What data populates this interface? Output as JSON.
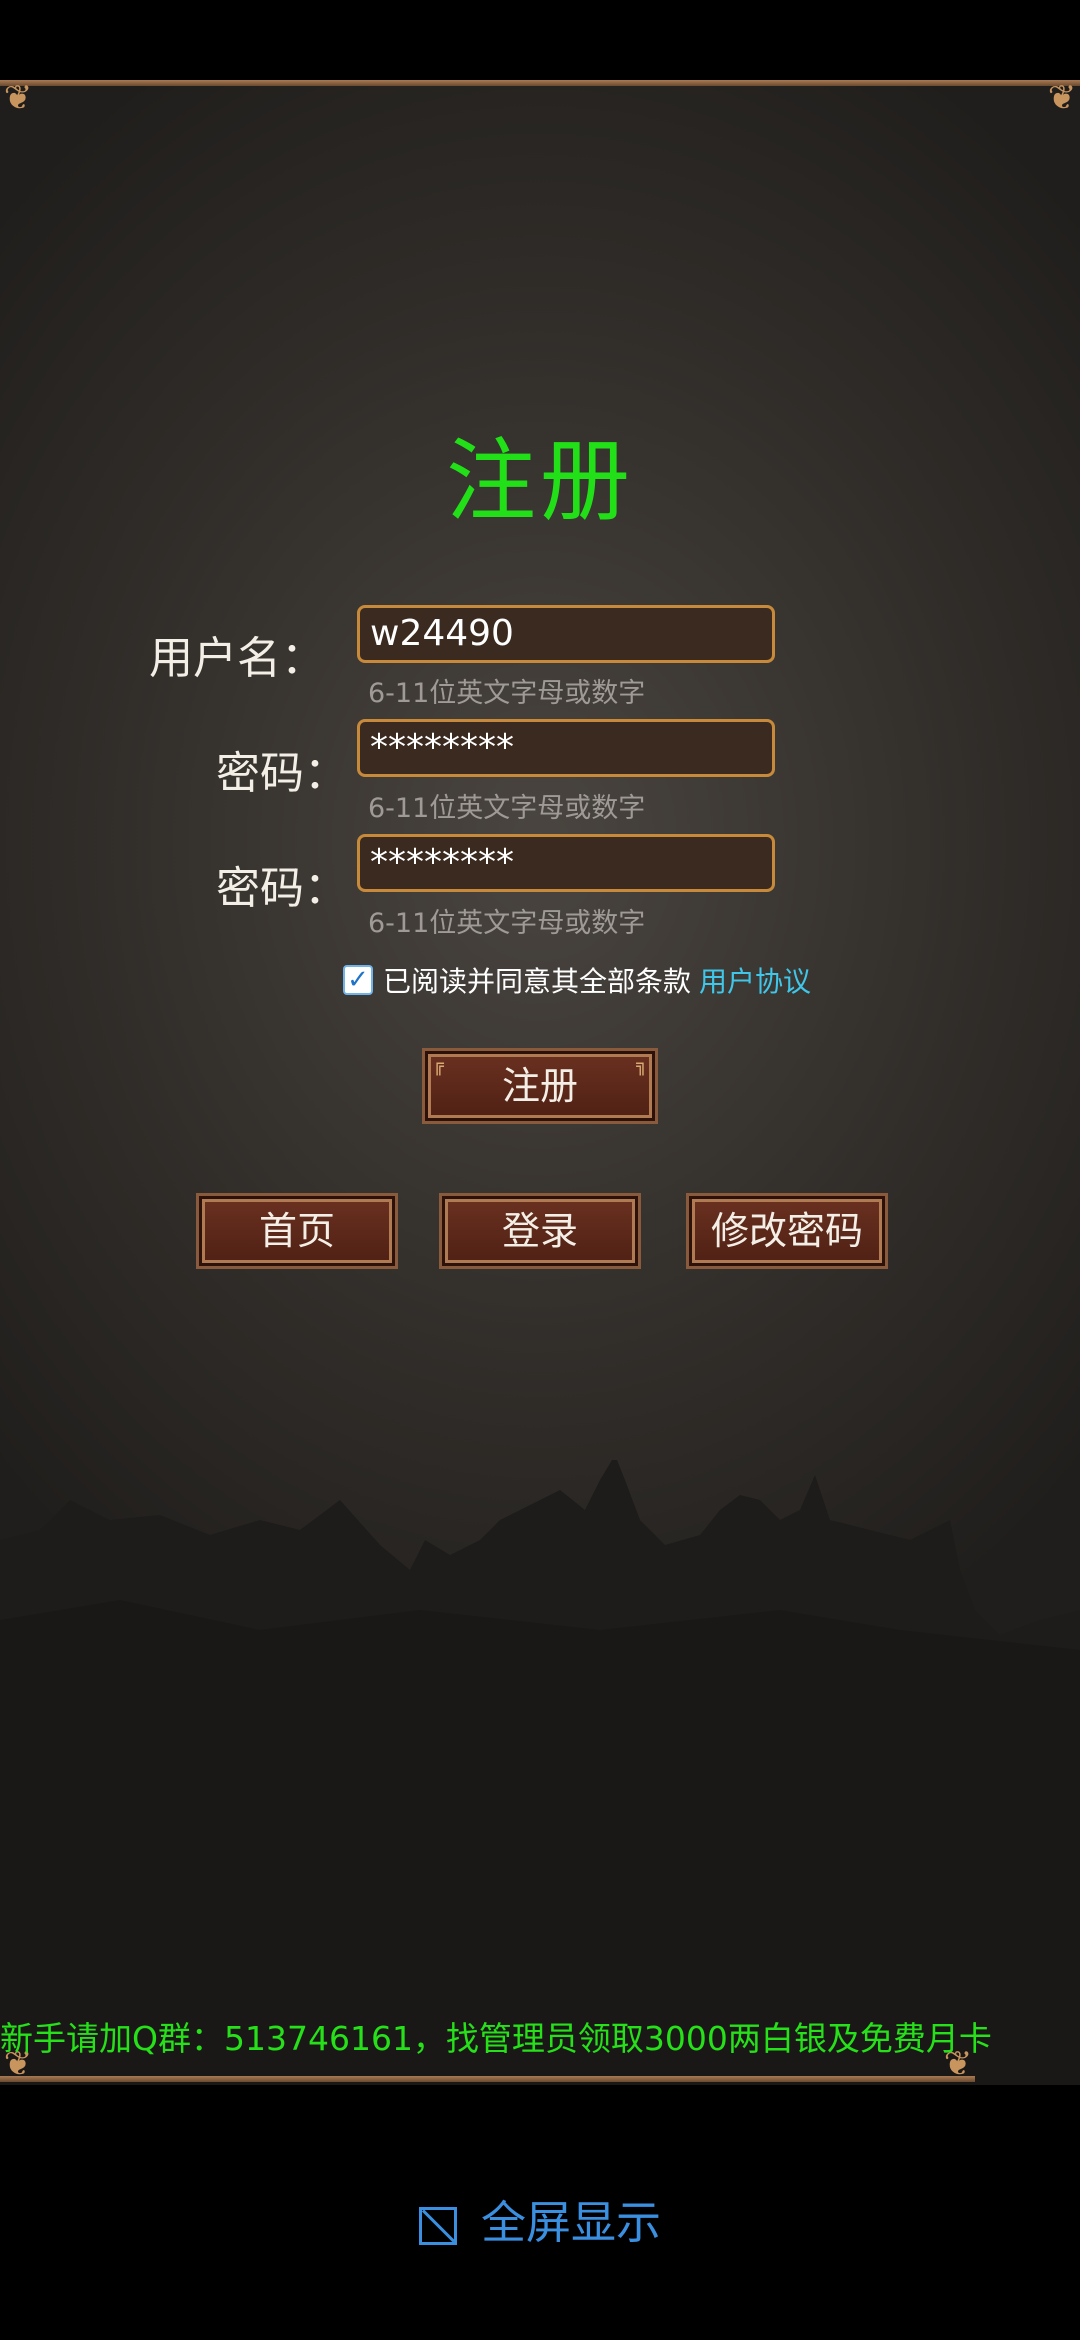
{
  "page_title": "注册",
  "form": {
    "username_label": "用户名：",
    "username_value": "w24490",
    "username_hint": "6-11位英文字母或数字",
    "password_label": "密码：",
    "password_value": "********",
    "password_hint": "6-11位英文字母或数字",
    "confirm_label": "密码：",
    "confirm_value": "********",
    "confirm_hint": "6-11位英文字母或数字"
  },
  "agreement": {
    "checked": true,
    "text": "已阅读并同意其全部条款",
    "link": "用户协议"
  },
  "buttons": {
    "register": "注册",
    "home": "首页",
    "login": "登录",
    "change_password": "修改密码"
  },
  "notice": "新手请加Q群：513746161，找管理员领取3000两白银及免费月卡",
  "fullscreen": {
    "label": "全屏显示",
    "icon": "fullscreen-icon"
  },
  "colors": {
    "title_green": "#22e018",
    "link_cyan": "#3fc6e8",
    "fullscreen_blue": "#3b8fe0",
    "input_border": "#c78a3a",
    "button_brown": "#6b3120"
  }
}
